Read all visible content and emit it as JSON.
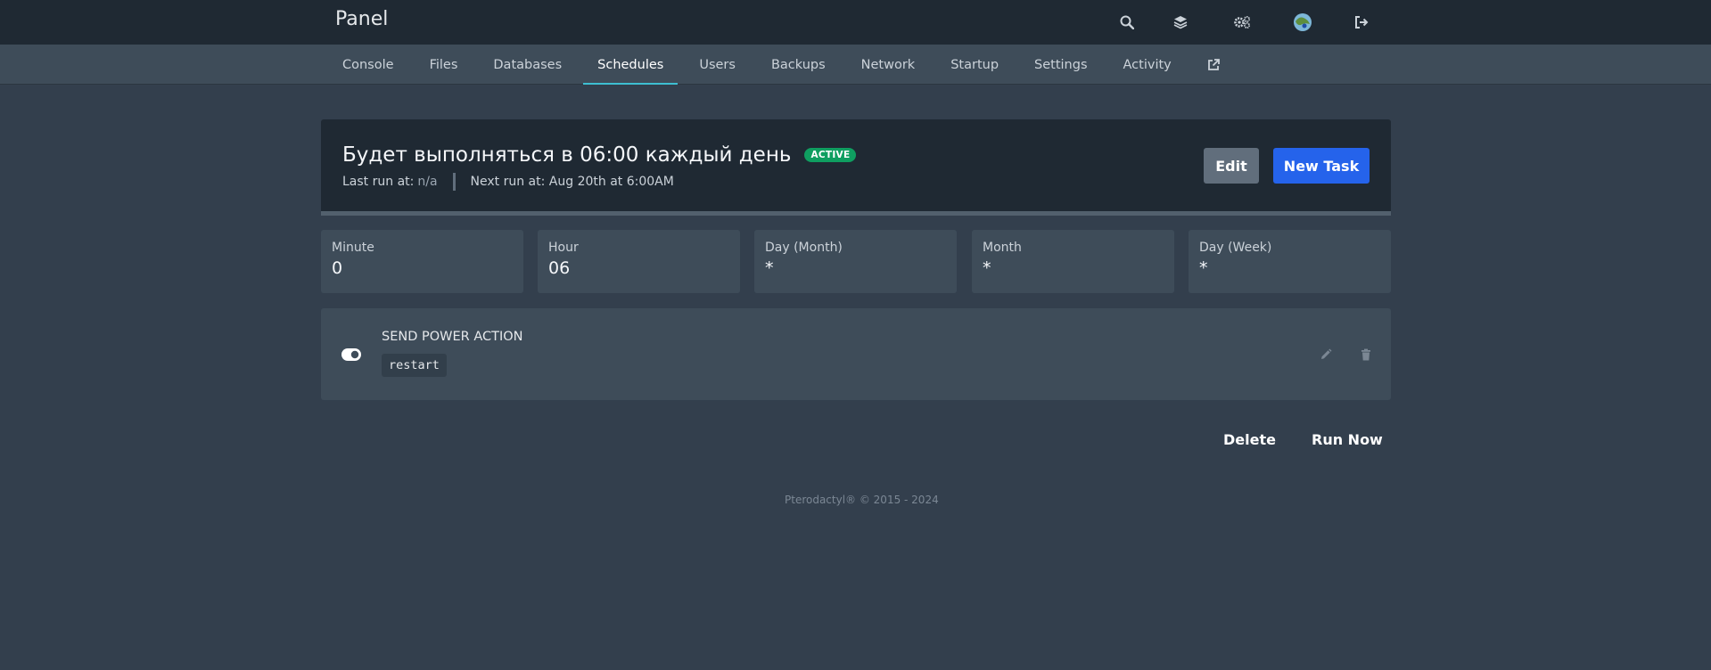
{
  "header": {
    "brand": "Panel",
    "icons": [
      "search-icon",
      "layers-icon",
      "cogs-icon",
      "avatar",
      "sign-out-icon"
    ]
  },
  "nav": {
    "tabs": [
      {
        "label": "Console"
      },
      {
        "label": "Files"
      },
      {
        "label": "Databases"
      },
      {
        "label": "Schedules",
        "active": true
      },
      {
        "label": "Users"
      },
      {
        "label": "Backups"
      },
      {
        "label": "Network"
      },
      {
        "label": "Startup"
      },
      {
        "label": "Settings"
      },
      {
        "label": "Activity"
      }
    ],
    "external_icon": "external-link-icon"
  },
  "schedule": {
    "title": "Будет выполняться в 06:00 каждый день",
    "status": "ACTIVE",
    "last_run_label": "Last run at:",
    "last_run_value": "n/a",
    "next_run": "Next run at: Aug 20th at 6:00AM",
    "edit_label": "Edit",
    "new_task_label": "New Task"
  },
  "cron": [
    {
      "label": "Minute",
      "value": "0"
    },
    {
      "label": "Hour",
      "value": "06"
    },
    {
      "label": "Day (Month)",
      "value": "*"
    },
    {
      "label": "Month",
      "value": "*"
    },
    {
      "label": "Day (Week)",
      "value": "*"
    }
  ],
  "task": {
    "title": "SEND POWER ACTION",
    "payload": "restart"
  },
  "actions": {
    "delete_label": "Delete",
    "run_now_label": "Run Now"
  },
  "footer": {
    "text": "Pterodactyl® © 2015 - 2024"
  },
  "colors": {
    "background": "#333f4d",
    "topbar": "#1f2933",
    "active_tab_indicator": "#3ebfd1",
    "badge": "#0f9e60",
    "primary_button": "#2563eb"
  }
}
